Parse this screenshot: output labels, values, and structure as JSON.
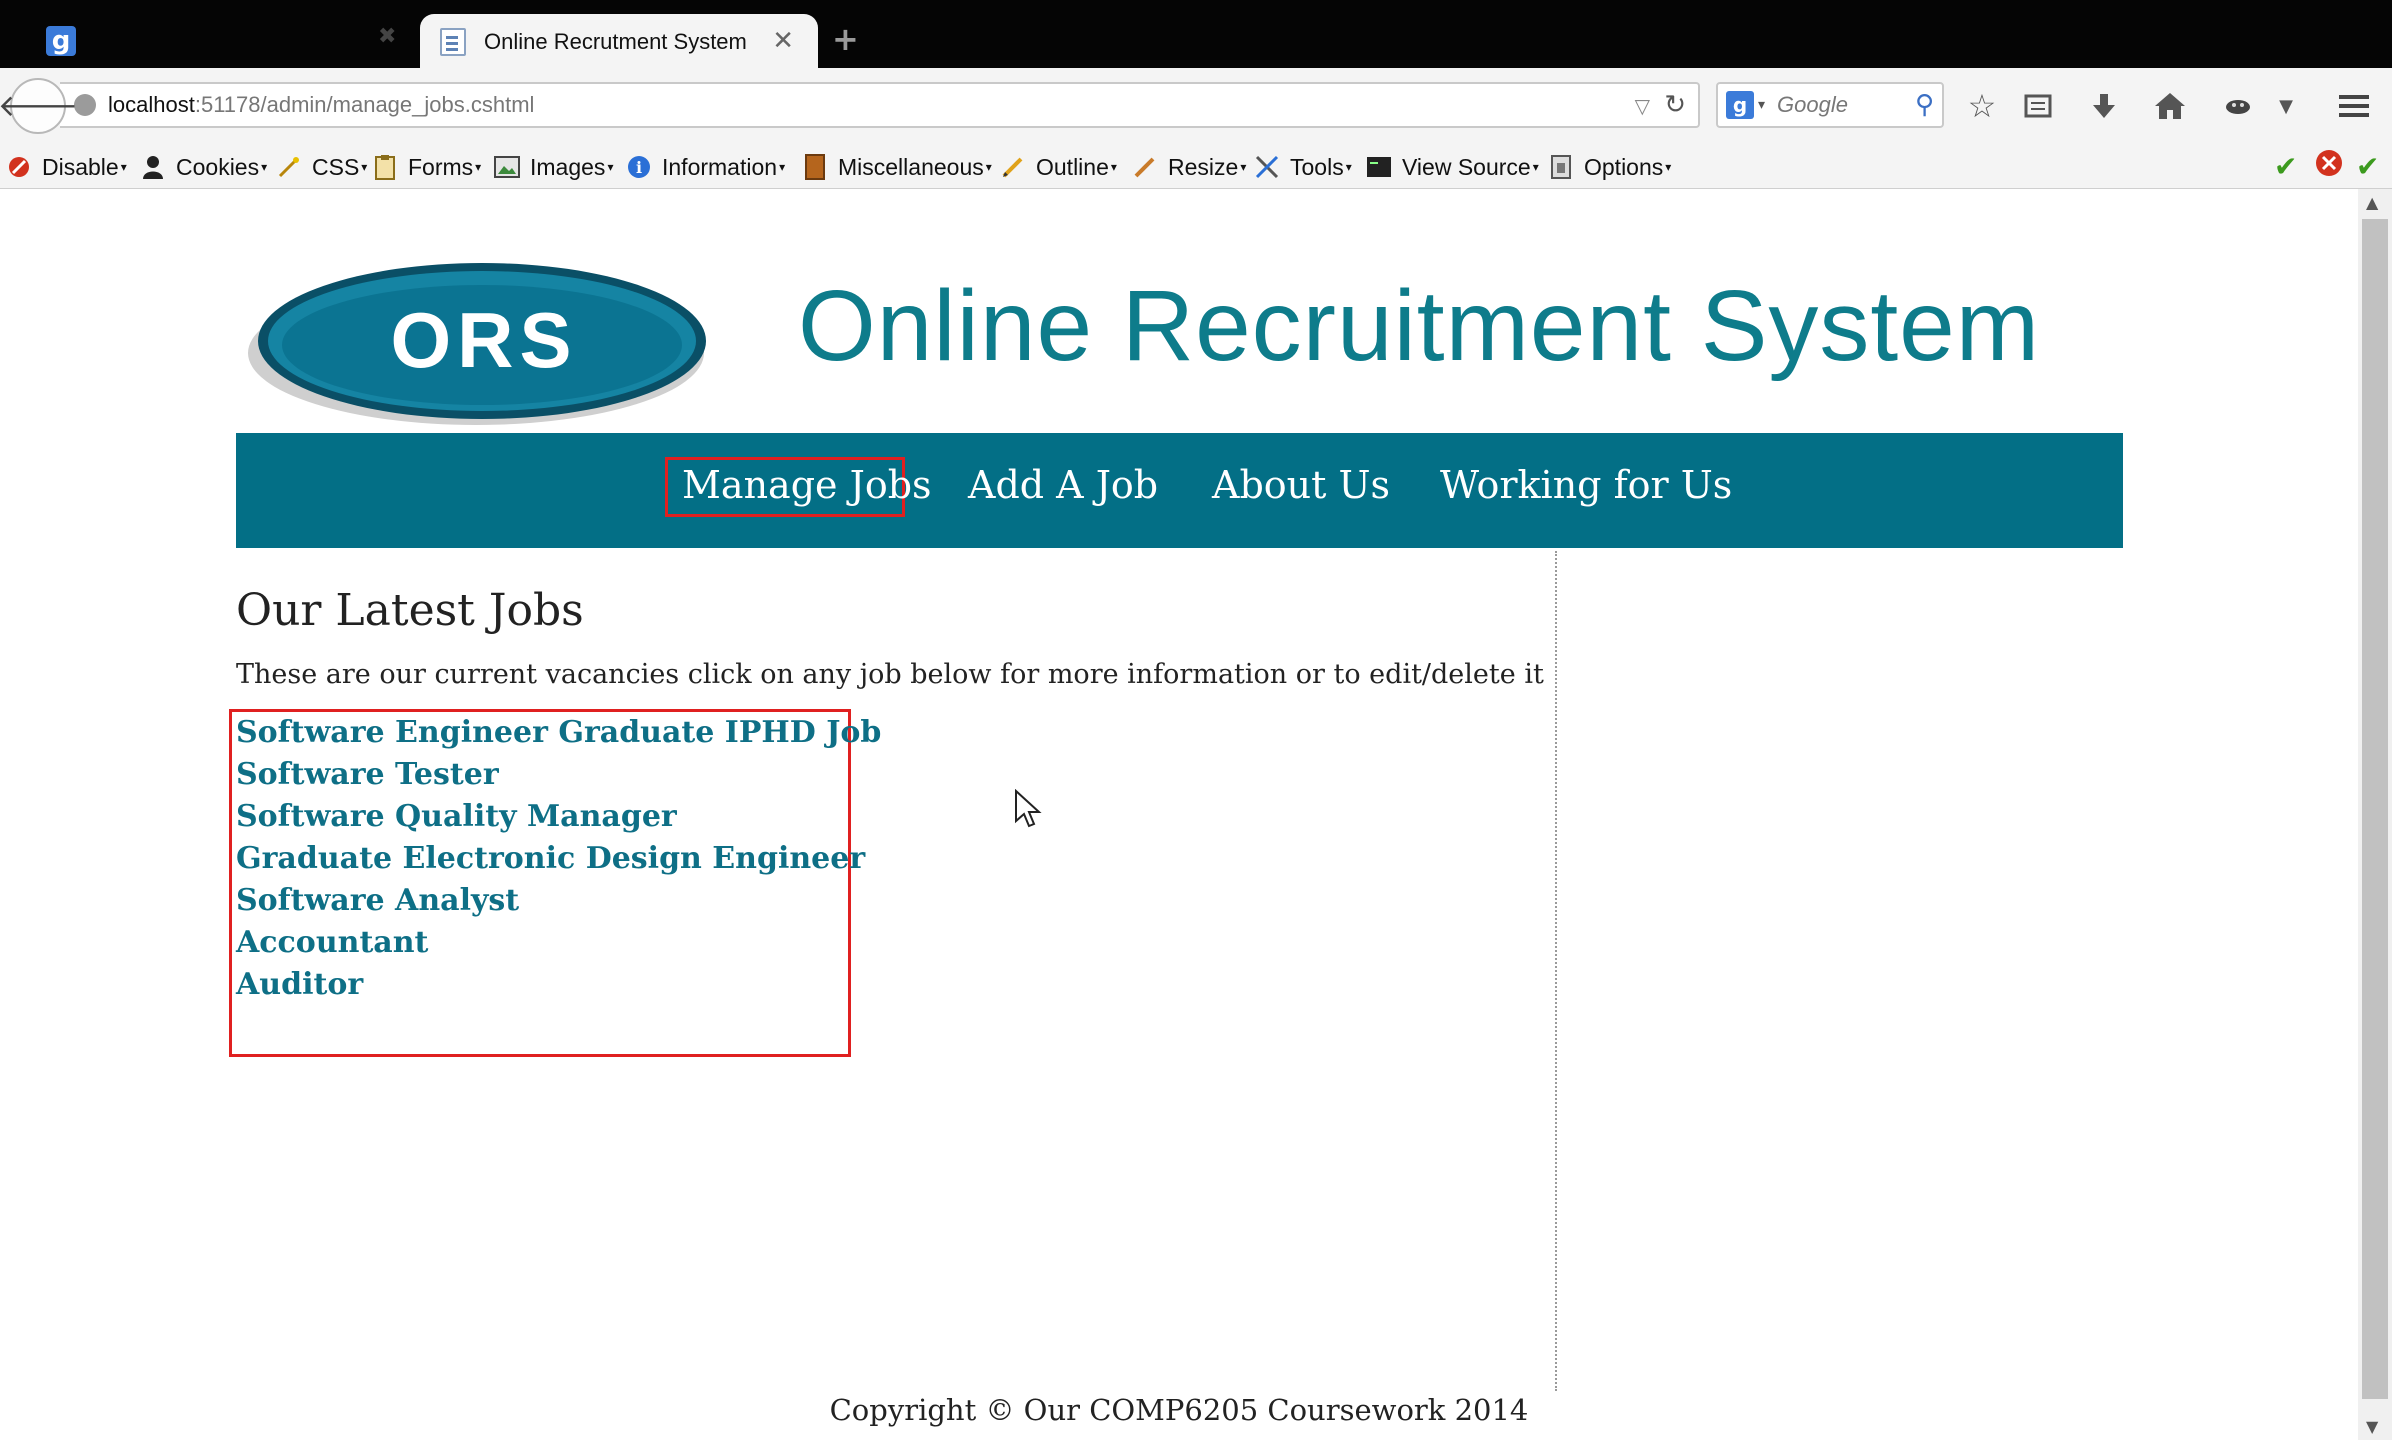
{
  "browser": {
    "active_tab_title": "Online Recrutment System",
    "new_tab_label": "+",
    "url_host": "localhost",
    "url_path": ":51178/admin/manage_jobs.cshtml",
    "search_placeholder": "Google",
    "search_engine_letter": "g"
  },
  "dev_toolbar": {
    "items": [
      {
        "label": "Disable",
        "icon": "disable-icon"
      },
      {
        "label": "Cookies",
        "icon": "cookie-icon"
      },
      {
        "label": "CSS",
        "icon": "css-icon"
      },
      {
        "label": "Forms",
        "icon": "forms-icon"
      },
      {
        "label": "Images",
        "icon": "images-icon"
      },
      {
        "label": "Information",
        "icon": "info-icon"
      },
      {
        "label": "Miscellaneous",
        "icon": "misc-icon"
      },
      {
        "label": "Outline",
        "icon": "outline-icon"
      },
      {
        "label": "Resize",
        "icon": "resize-icon"
      },
      {
        "label": "Tools",
        "icon": "tools-icon"
      },
      {
        "label": "View Source",
        "icon": "view-source-icon"
      },
      {
        "label": "Options",
        "icon": "options-icon"
      }
    ]
  },
  "site": {
    "logo_text": "ORS",
    "title": "Online Recruitment System",
    "nav": [
      "Manage Jobs",
      "Add A Job",
      "About Us",
      "Working for Us"
    ],
    "active_nav": "Manage Jobs",
    "heading": "Our Latest Jobs",
    "intro": "These are our current vacancies click on any job below for more information or to edit/delete it",
    "jobs": [
      "Software Engineer Graduate IPHD Job",
      "Software Tester",
      "Software Quality Manager",
      "Graduate Electronic Design Engineer",
      "Software Analyst",
      "Accountant",
      "Auditor"
    ],
    "footer": "Copyright © Our COMP6205 Coursework 2014"
  },
  "colors": {
    "brand_teal": "#036f86",
    "title_teal": "#0e7c8b",
    "link_teal": "#0e6f86",
    "highlight_red": "#e02020"
  }
}
